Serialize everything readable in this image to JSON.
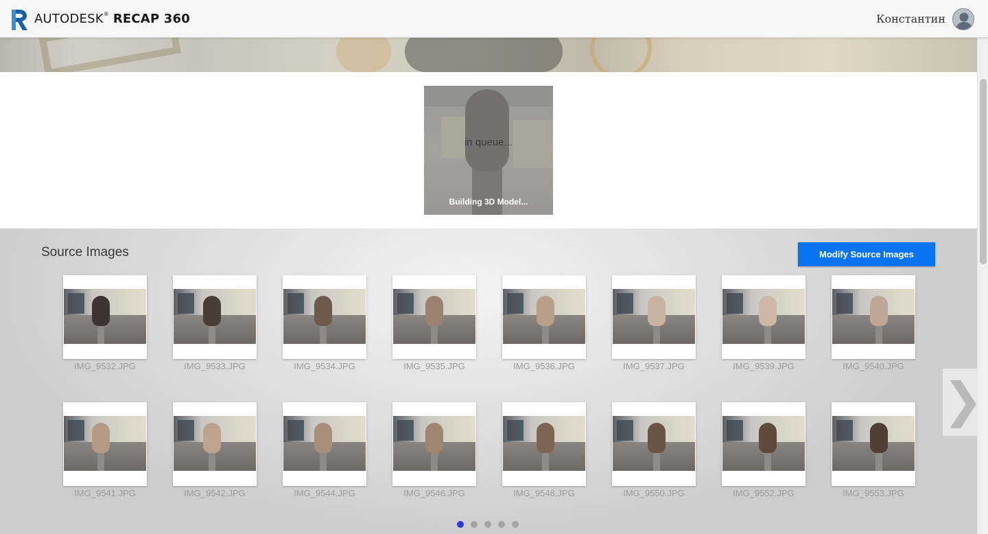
{
  "header": {
    "brand_company": "AUTODESK",
    "brand_product": "RECAP 360",
    "logo_icon": "recap-r-logo-icon",
    "user_name": "Константин",
    "avatar_icon": "user-avatar-icon",
    "colors": {
      "logo": "#1b5fa8",
      "header_bg": "#f7f7f7"
    }
  },
  "model": {
    "status_text": "in queue...",
    "progress_label": "Building 3D Model..."
  },
  "source_images": {
    "title": "Source Images",
    "modify_button": "Modify Source Images",
    "accent_color": "#0a73f0",
    "images": [
      "IMG_9532.JPG",
      "IMG_9533.JPG",
      "IMG_9534.JPG",
      "IMG_9535.JPG",
      "IMG_9536.JPG",
      "IMG_9537.JPG",
      "IMG_9539.JPG",
      "IMG_9540.JPG",
      "IMG_9541.JPG",
      "IMG_9542.JPG",
      "IMG_9544.JPG",
      "IMG_9546.JPG",
      "IMG_9548.JPG",
      "IMG_9550.JPG",
      "IMG_9552.JPG",
      "IMG_9553.JPG"
    ],
    "next_icon": "chevron-right-icon",
    "pagination": {
      "pages": 5,
      "current": 1,
      "active_color": "#2b3bd6"
    }
  }
}
